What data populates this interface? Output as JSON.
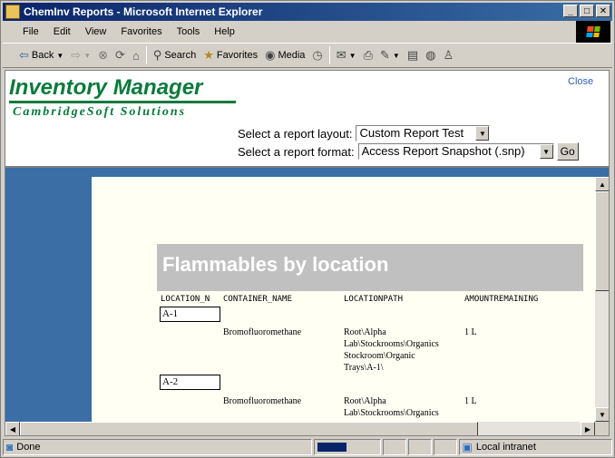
{
  "window": {
    "title": "ChemInv Reports - Microsoft Internet Explorer",
    "minimize": "_",
    "maximize": "□",
    "close": "✕"
  },
  "menu": [
    "File",
    "Edit",
    "View",
    "Favorites",
    "Tools",
    "Help"
  ],
  "toolbar": {
    "back": "Back",
    "search": "Search",
    "favorites": "Favorites",
    "media": "Media"
  },
  "page": {
    "logo_main": "Inventory Manager",
    "logo_sub": "CambridgeSoft Solutions",
    "close_link": "Close",
    "layout_label": "Select a report layout:",
    "layout_value": "Custom Report Test",
    "format_label": "Select a report format:",
    "format_value": "Access Report Snapshot (.snp)",
    "go_button": "Go"
  },
  "report": {
    "title": "Flammables by location",
    "columns": [
      "LOCATION_N",
      "CONTAINER_NAME",
      "LOCATIONPATH",
      "AMOUNTREMAINING"
    ],
    "groups": [
      {
        "location": "A-1",
        "container": "Bromofluoromethane",
        "path": [
          "Root\\Alpha",
          "Lab\\Stockrooms\\Organics",
          "Stockroom\\Organic",
          "Trays\\A-1\\"
        ],
        "amount": "1 L"
      },
      {
        "location": "A-2",
        "container": "Bromofluoromethane",
        "path": [
          "Root\\Alpha",
          "Lab\\Stockrooms\\Organics"
        ],
        "amount": "1 L"
      }
    ]
  },
  "status": {
    "text": "Done",
    "zone": "Local intranet"
  },
  "colors": {
    "title_bar": "#0a246a",
    "logo_green": "#0a7a3c",
    "frame_blue": "#3a6ea5"
  }
}
